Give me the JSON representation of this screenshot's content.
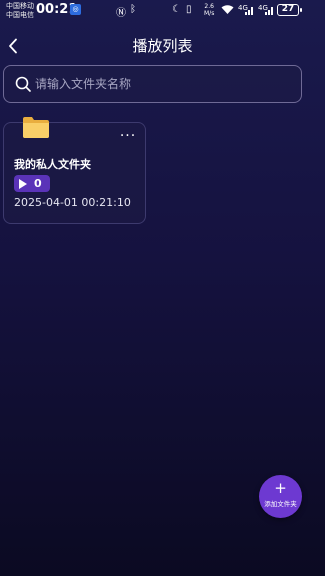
{
  "status_bar": {
    "carrier_1": "中国移动",
    "carrier_2": "中国电信",
    "time": "00:21",
    "speed_value": "2.6",
    "speed_unit": "M/s",
    "signal_1": "4G",
    "signal_2": "4G",
    "battery": "27"
  },
  "header": {
    "title": "播放列表"
  },
  "search": {
    "placeholder": "请输入文件夹名称"
  },
  "folders": [
    {
      "name": "我的私人文件夹",
      "play_count": "0",
      "date": "2025-04-01 00:21:10",
      "more": "···"
    }
  ],
  "fab": {
    "plus": "+",
    "label": "添加文件夹"
  },
  "icons": {
    "back": "chevron-left-icon",
    "search": "search-icon",
    "folder": "folder-icon",
    "play": "play-icon",
    "more": "more-horizontal-icon"
  },
  "colors": {
    "accent": "#6d39d1",
    "badge": "#5a33b8",
    "folder": "#f6c85f"
  }
}
